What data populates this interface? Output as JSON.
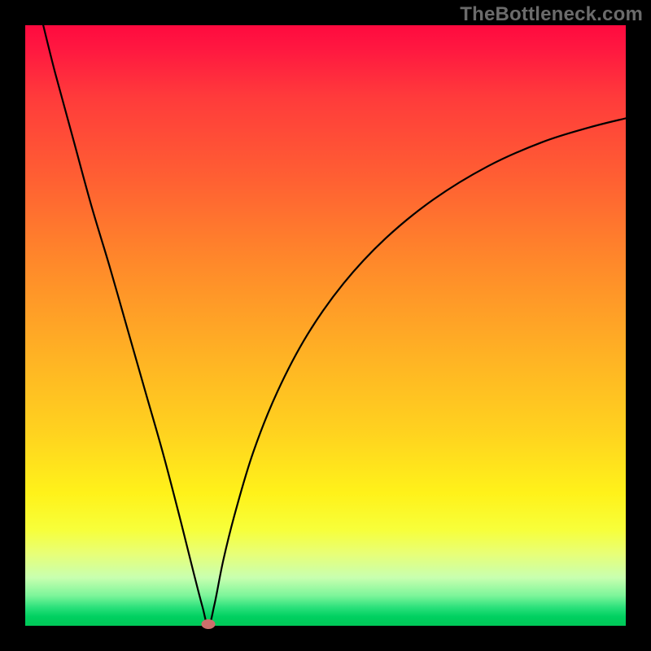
{
  "watermark": "TheBottleneck.com",
  "colors": {
    "frame": "#000000",
    "curve": "#000000",
    "marker": "#cc6f6c",
    "gradient_top": "#ff0a3f",
    "gradient_mid": "#ffd31f",
    "gradient_bottom": "#00c858"
  },
  "chart_data": {
    "type": "line",
    "title": "",
    "xlabel": "",
    "ylabel": "",
    "xlim": [
      0,
      100
    ],
    "ylim": [
      0,
      100
    ],
    "grid": false,
    "legend": false,
    "annotations": [
      "TheBottleneck.com"
    ],
    "min_marker": {
      "x": 30.5,
      "y": 0
    },
    "series": [
      {
        "name": "bottleneck-curve",
        "x": [
          3,
          5,
          8,
          11,
          14,
          17,
          20,
          23,
          26,
          28,
          29.5,
          30.5,
          31.5,
          33,
          35,
          38,
          42,
          47,
          53,
          60,
          68,
          77,
          86,
          94,
          100
        ],
        "y": [
          100,
          92,
          81,
          70,
          60,
          49.5,
          39,
          28.5,
          17,
          9,
          3.2,
          0,
          3.5,
          11,
          19,
          29,
          39,
          48.5,
          57,
          64.5,
          71,
          76.5,
          80.5,
          83,
          84.5
        ]
      }
    ]
  }
}
